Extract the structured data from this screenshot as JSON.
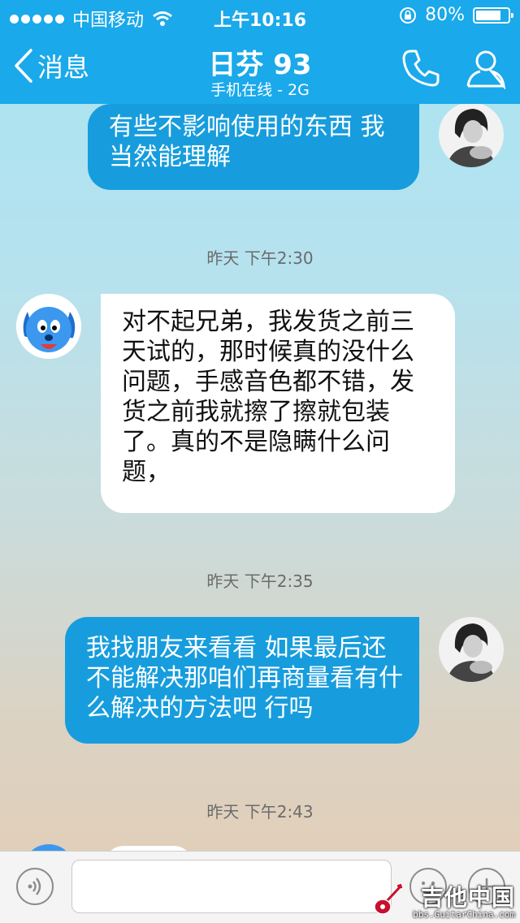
{
  "status_bar": {
    "carrier": "中国移动",
    "time": "上午10:16",
    "battery": "80%",
    "battery_level": 0.8,
    "icons": [
      "signal-dots-icon",
      "wifi-icon",
      "orientation-lock-icon",
      "battery-icon"
    ]
  },
  "nav": {
    "back_label": "消息",
    "title": "日芬 93",
    "subtitle": "手机在线 - 2G",
    "icons": [
      "back-chevron-icon",
      "phone-icon",
      "profile-icon"
    ]
  },
  "messages": [
    {
      "direction": "out",
      "text": "有些不影响使用的东西 我当然能理解"
    },
    {
      "type": "timestamp",
      "text": "昨天 下午2:30"
    },
    {
      "direction": "in",
      "text": "对不起兄弟，我发货之前三天试的，那时候真的没什么问题，手感音色都不错，发货之前我就擦了擦就包装了。真的不是隐瞒什么问题，"
    },
    {
      "type": "timestamp",
      "text": "昨天 下午2:35"
    },
    {
      "direction": "out",
      "text": "我找朋友来看看 如果最后还不能解决那咱们再商量看有什么解决的方法吧 行吗"
    },
    {
      "type": "timestamp",
      "text": "昨天 下午2:43"
    }
  ],
  "input_bar": {
    "placeholder": "",
    "icons": [
      "voice-icon",
      "emoji-icon",
      "plus-icon"
    ]
  },
  "watermark": {
    "text": "吉他中国",
    "url": "bbs.GuitarChina.com"
  },
  "colors": {
    "header": "#1aa9ea",
    "outgoing_bubble": "#179ddd",
    "incoming_bubble": "#ffffff"
  }
}
